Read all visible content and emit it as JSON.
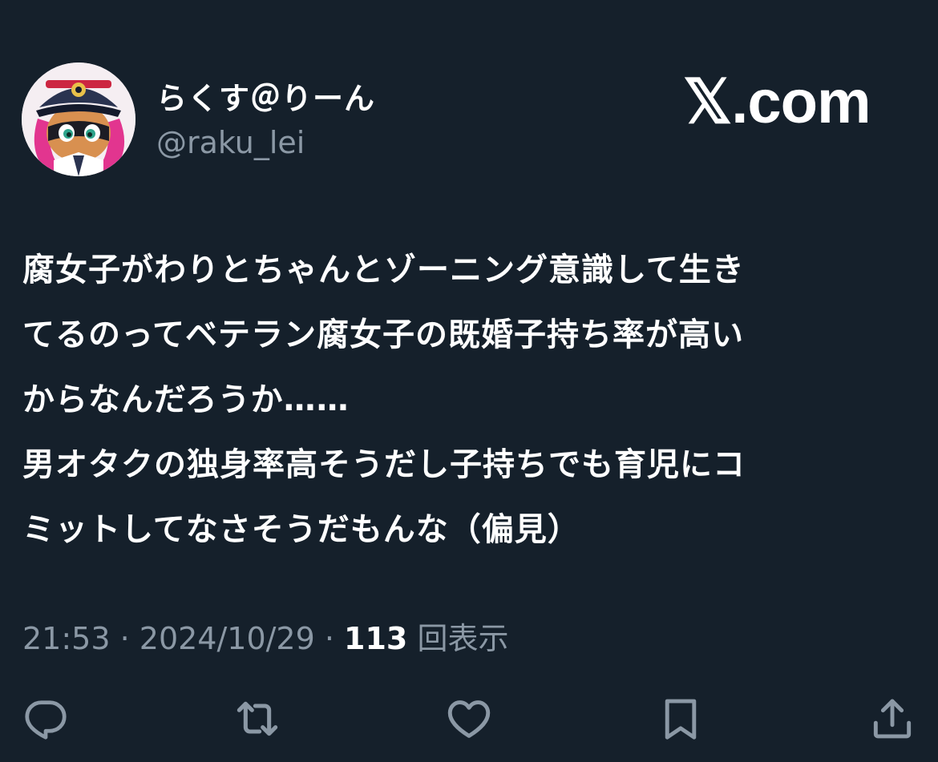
{
  "author": {
    "display_name": "らくす＠りーん",
    "handle": "@raku_lei"
  },
  "watermark": {
    "text": "𝕏.com"
  },
  "tweet": {
    "lines": [
      "腐女子がわりとちゃんとゾーニング意識して生き",
      "てるのってベテラン腐女子の既婚子持ち率が高い",
      "からなんだろうか……",
      "男オタクの独身率高そうだし子持ちでも育児にコ",
      "ミットしてなさそうだもんな（偏見）"
    ]
  },
  "meta": {
    "time": "21:53",
    "separator": " · ",
    "date": "2024/10/29",
    "views_count": "113",
    "views_label": "回表示"
  },
  "actions": [
    {
      "icon": "reply-icon"
    },
    {
      "icon": "retweet-icon"
    },
    {
      "icon": "like-icon"
    },
    {
      "icon": "bookmark-icon"
    },
    {
      "icon": "share-icon"
    }
  ],
  "colors": {
    "background": "#15202b",
    "text": "#ffffff",
    "secondary_text": "#8b98a5"
  }
}
